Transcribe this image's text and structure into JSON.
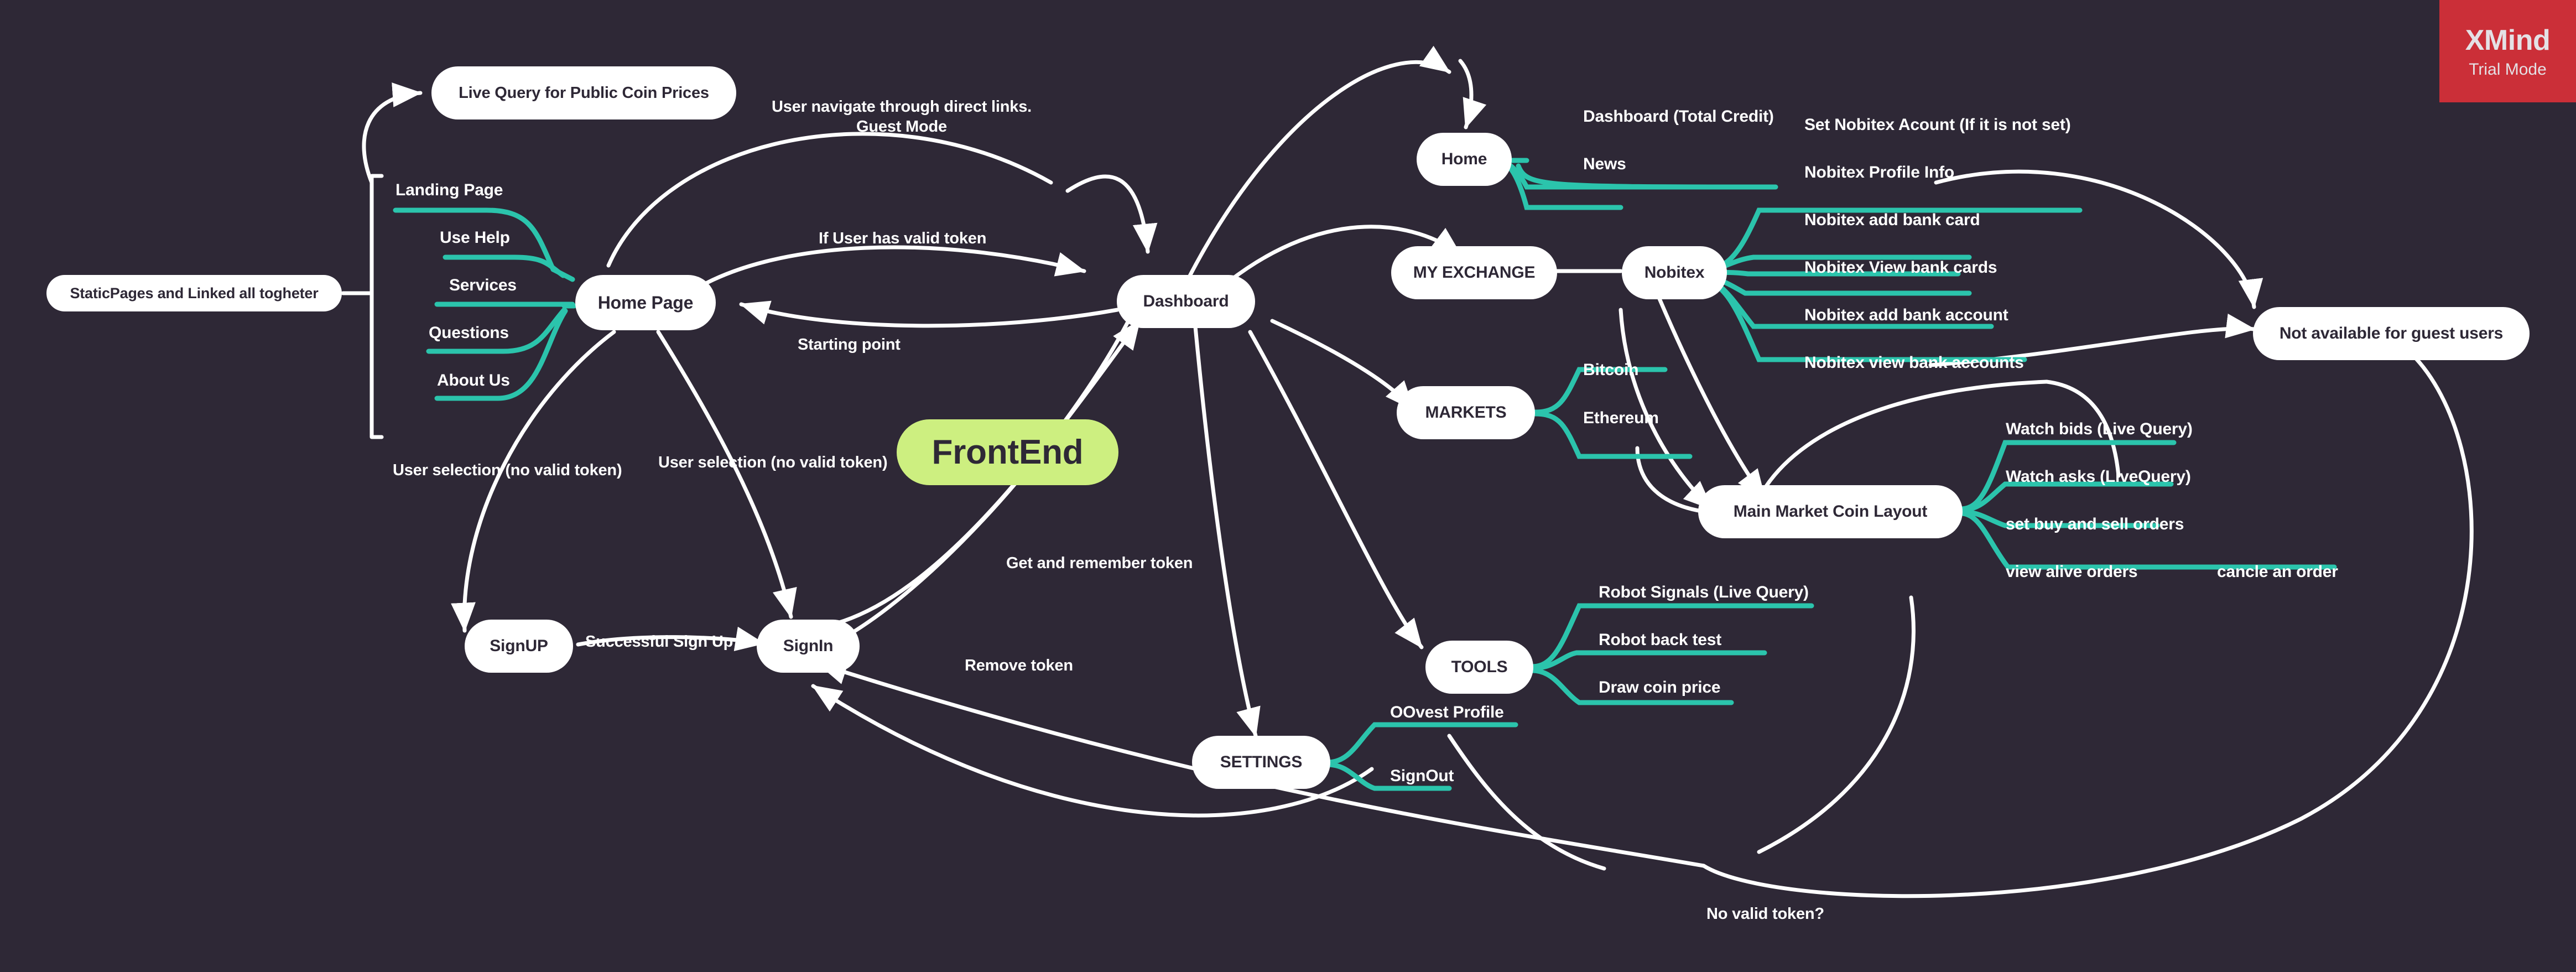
{
  "watermark": {
    "title": "XMind",
    "subtitle": "Trial Mode"
  },
  "central": {
    "label": "FrontEnd"
  },
  "nodes": {
    "static_pages": "StaticPages and Linked all togheter",
    "live_query_public": "Live Query for Public Coin Prices",
    "home_page": "Home Page",
    "signup": "SignUP",
    "signin": "SignIn",
    "dashboard": "Dashboard",
    "home": "Home",
    "my_exchange": "MY EXCHANGE",
    "nobitex": "Nobitex",
    "markets": "MARKETS",
    "main_market_coin_layout": "Main Market Coin Layout",
    "tools": "TOOLS",
    "settings": "SETTINGS",
    "not_available_guest": "Not available for guest users"
  },
  "home_page_children": [
    {
      "label": "Landing Page"
    },
    {
      "label": "Use Help"
    },
    {
      "label": "Services"
    },
    {
      "label": "Questions"
    },
    {
      "label": "About Us"
    }
  ],
  "home_children": [
    {
      "label": "Dashboard (Total Credit)"
    },
    {
      "label": "News"
    }
  ],
  "nobitex_children": [
    {
      "label": "Set Nobitex Acount (If it is not set)"
    },
    {
      "label": "Nobitex Profile Info"
    },
    {
      "label": "Nobitex add bank card"
    },
    {
      "label": "Nobitex View bank cards"
    },
    {
      "label": "Nobitex add bank account"
    },
    {
      "label": "Nobitex view bank accounts"
    }
  ],
  "markets_children": [
    {
      "label": "Bitcoin"
    },
    {
      "label": "Ethereum"
    }
  ],
  "market_layout_children": [
    {
      "label": "Watch bids (Live Query)"
    },
    {
      "label": "Watch asks (LiveQuery)"
    },
    {
      "label": "set buy and sell orders"
    },
    {
      "label": "view alive orders"
    },
    {
      "label": "cancle an order"
    }
  ],
  "tools_children": [
    {
      "label": "Robot Signals (Live Query)"
    },
    {
      "label": "Robot back test"
    },
    {
      "label": "Draw coin price"
    }
  ],
  "settings_children": [
    {
      "label": "OOvest Profile"
    },
    {
      "label": "SignOut"
    }
  ],
  "edge_labels": {
    "guest_mode": "User navigate through direct links. Guest Mode",
    "valid_token": "If User has valid token",
    "starting_point": "Starting point",
    "user_selection_left": "User selection (no valid token)",
    "user_selection_right": "User selection (no valid token)",
    "successful_signup": "Successful Sign Up",
    "get_remember_token": "Get and remember token",
    "remove_token": "Remove token",
    "no_valid_token": "No valid token?"
  },
  "colors": {
    "background": "#2E2836",
    "node_fill": "#FFFFFF",
    "node_text": "#2E2836",
    "central_fill": "#CDEF80",
    "branch_teal": "#2BC4AC",
    "edge_white": "#FFFFFF",
    "watermark_red": "#CB2F38"
  }
}
